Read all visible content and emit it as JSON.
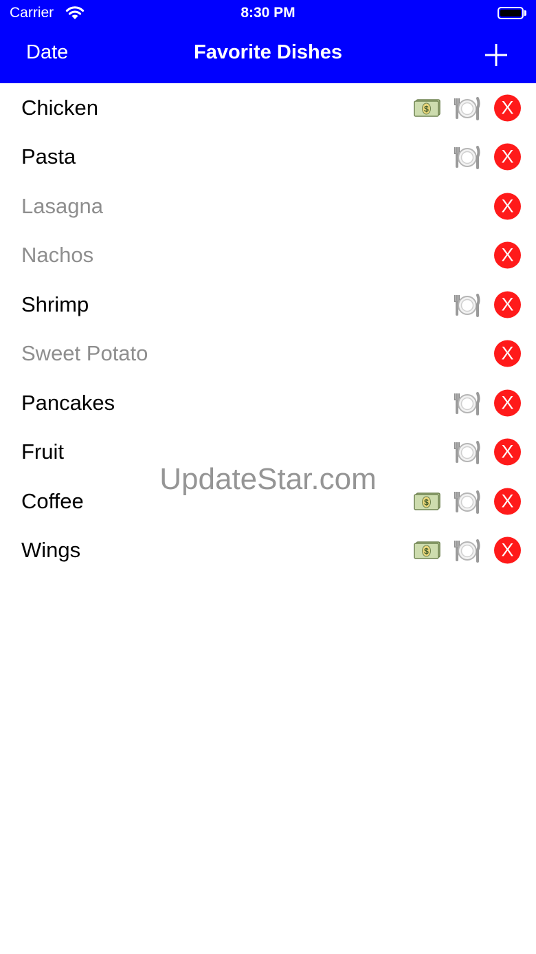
{
  "status_bar": {
    "carrier": "Carrier",
    "time": "8:30 PM"
  },
  "nav": {
    "left_button": "Date",
    "title": "Favorite Dishes",
    "add_icon": "plus-icon"
  },
  "dishes": [
    {
      "name": "Chicken",
      "muted": false,
      "money": true,
      "plate": true
    },
    {
      "name": "Pasta",
      "muted": false,
      "money": false,
      "plate": true
    },
    {
      "name": "Lasagna",
      "muted": true,
      "money": false,
      "plate": false
    },
    {
      "name": "Nachos",
      "muted": true,
      "money": false,
      "plate": false
    },
    {
      "name": "Shrimp",
      "muted": false,
      "money": false,
      "plate": true
    },
    {
      "name": "Sweet Potato",
      "muted": true,
      "money": false,
      "plate": false
    },
    {
      "name": "Pancakes",
      "muted": false,
      "money": false,
      "plate": true
    },
    {
      "name": "Fruit",
      "muted": false,
      "money": false,
      "plate": true
    },
    {
      "name": "Coffee",
      "muted": false,
      "money": true,
      "plate": true
    },
    {
      "name": "Wings",
      "muted": false,
      "money": true,
      "plate": true
    }
  ],
  "delete_label": "X",
  "watermark": "UpdateStar.com",
  "colors": {
    "nav_background": "#0000ff",
    "delete_button": "#ff1a1a",
    "muted_text": "#8e8e8e"
  }
}
